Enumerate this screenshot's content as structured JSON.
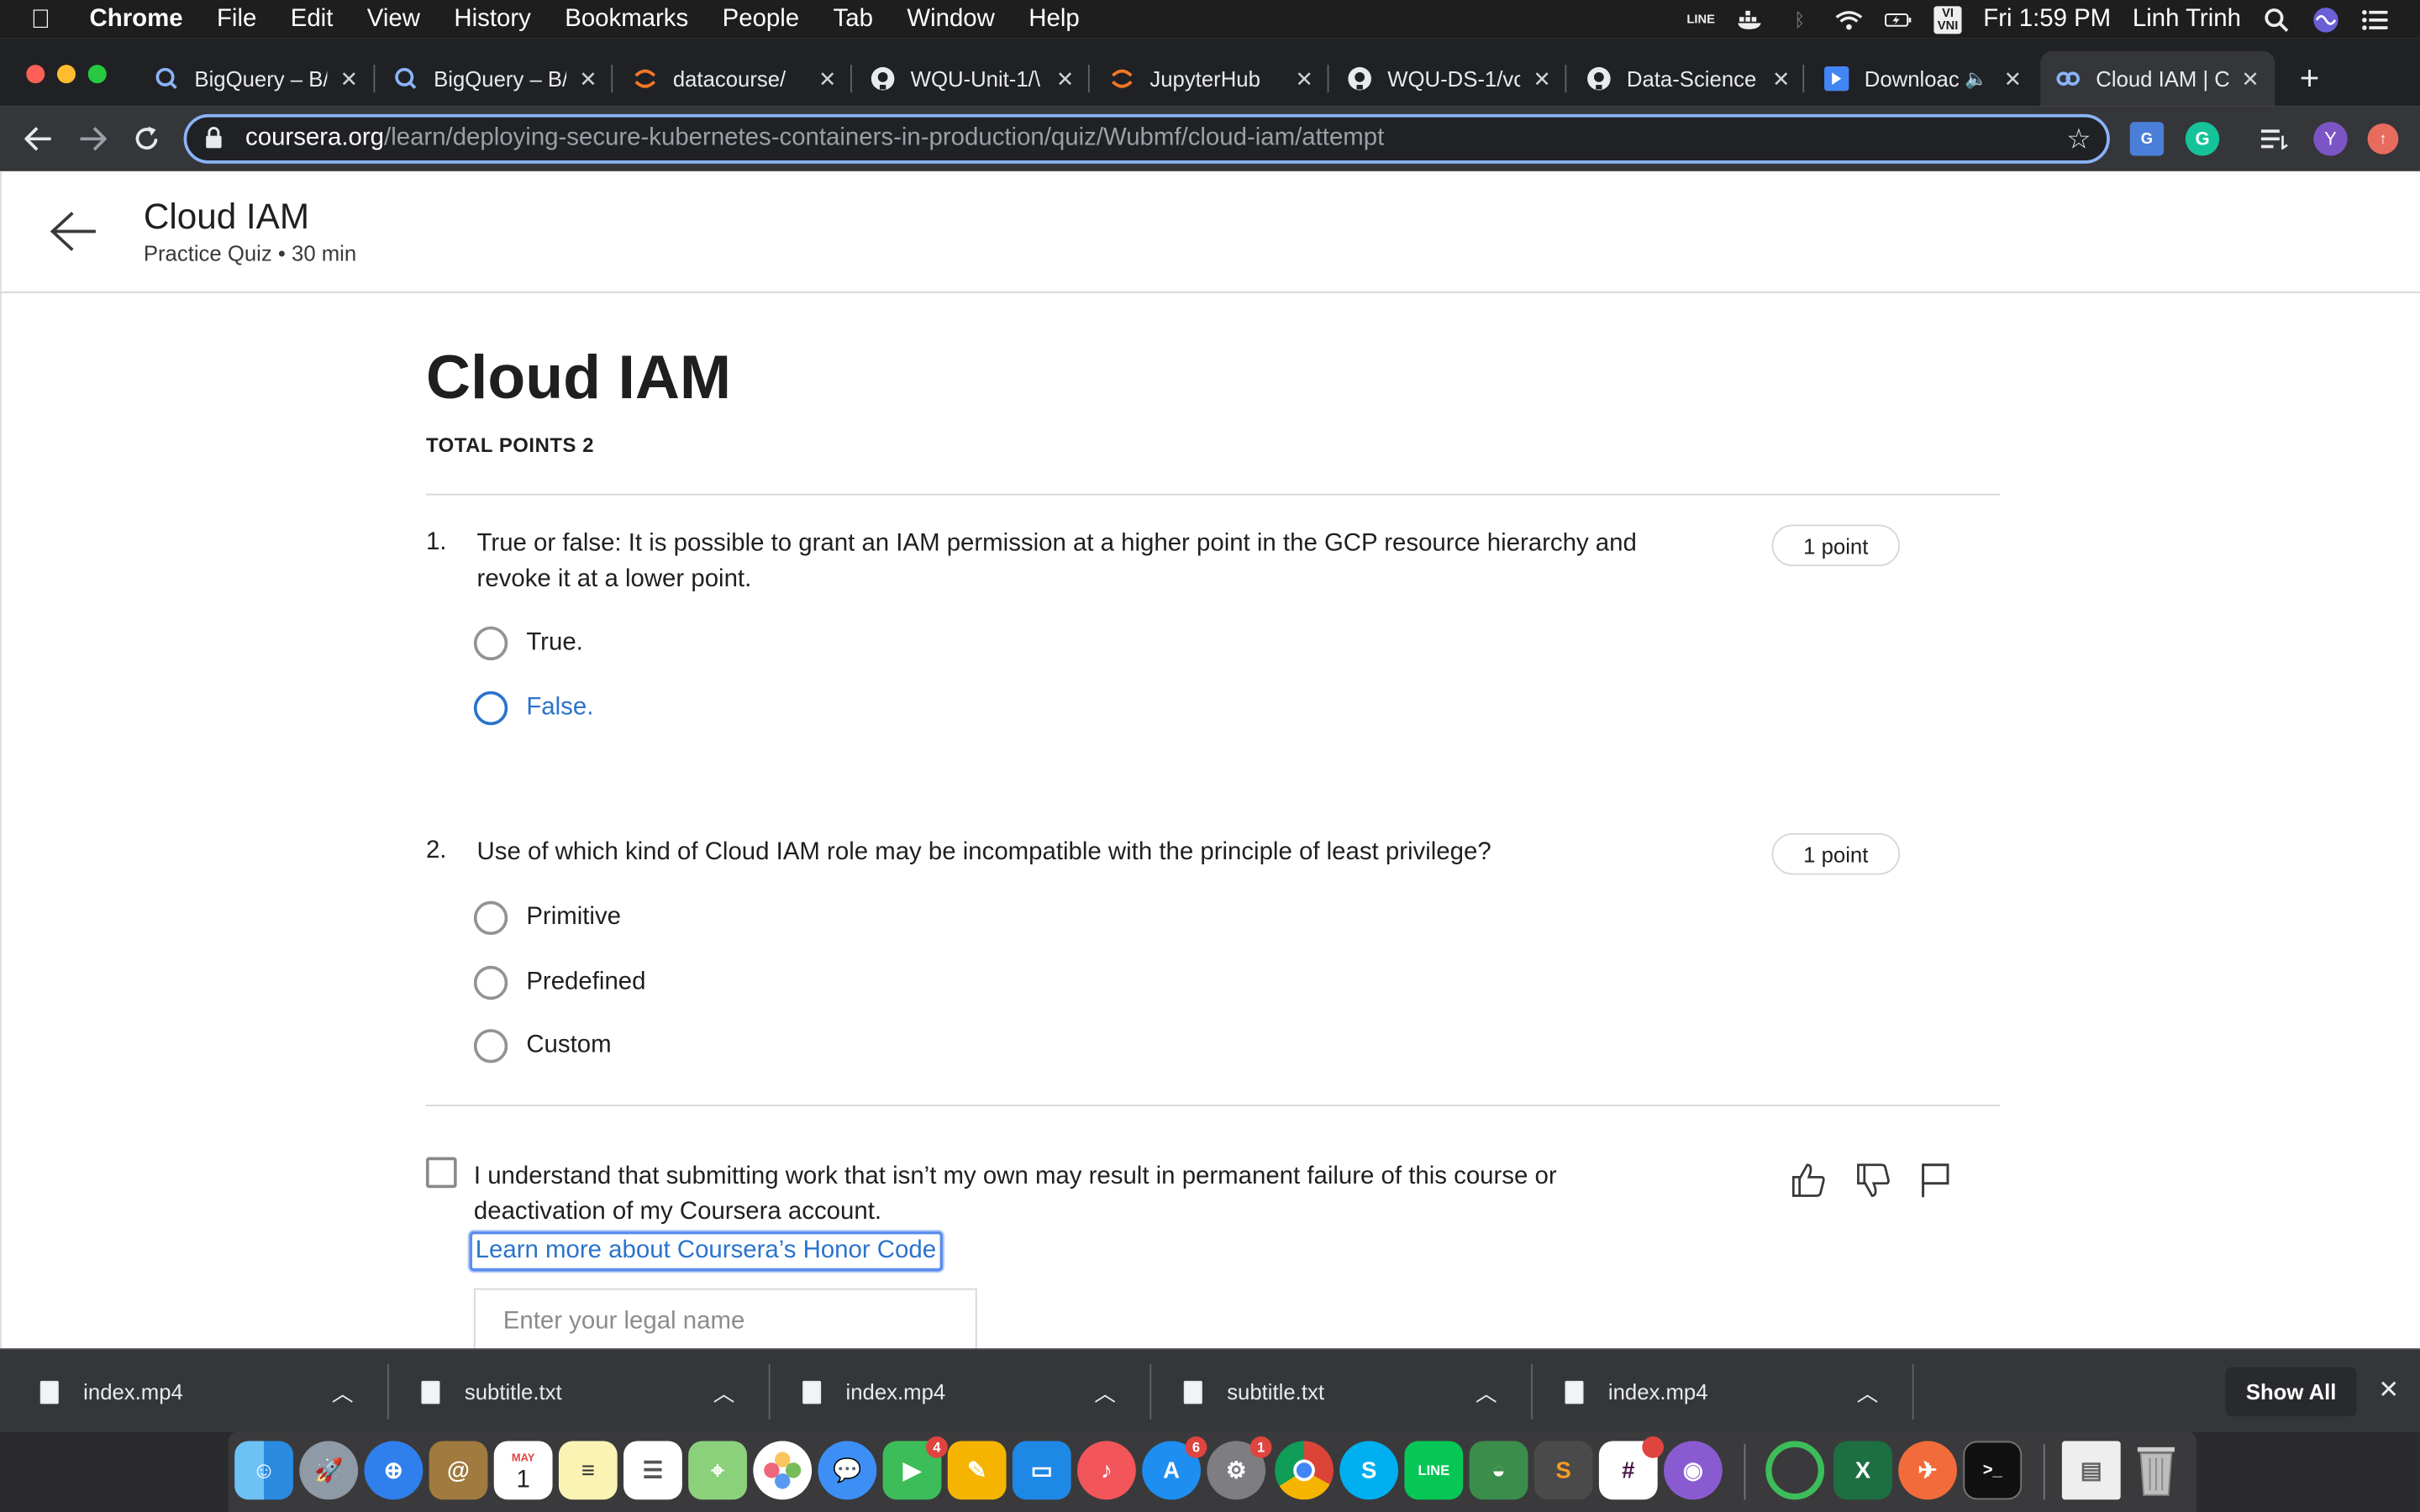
{
  "menubar": {
    "app": "Chrome",
    "items": [
      "File",
      "Edit",
      "View",
      "History",
      "Bookmarks",
      "People",
      "Tab",
      "Window",
      "Help"
    ],
    "clock": "Fri 1:59 PM",
    "user": "Linh Trinh",
    "input_source": "VI VNI"
  },
  "tabs": [
    {
      "title": "BigQuery – B/",
      "icon": "bigquery-icon"
    },
    {
      "title": "BigQuery – B/",
      "icon": "bigquery-icon"
    },
    {
      "title": "datacourse/",
      "icon": "jupyter-icon"
    },
    {
      "title": "WQU-Unit-1/\\",
      "icon": "github-icon"
    },
    {
      "title": "JupyterHub",
      "icon": "jupyter-icon"
    },
    {
      "title": "WQU-DS-1/vc",
      "icon": "github-icon"
    },
    {
      "title": "Data-Science",
      "icon": "github-icon"
    },
    {
      "title": "Downloac",
      "icon": "download-page-icon"
    },
    {
      "title": "Cloud IAM | C",
      "icon": "coursera-icon"
    }
  ],
  "address_bar": {
    "domain": "coursera.org",
    "path": "/learn/deploying-secure-kubernetes-containers-in-production/quiz/Wubmf/cloud-iam/attempt"
  },
  "extensions": {
    "profile_initial": "Y"
  },
  "header": {
    "title": "Cloud IAM",
    "subtitle": "Practice Quiz • 30 min"
  },
  "quiz": {
    "title": "Cloud IAM",
    "total_points": "TOTAL POINTS 2",
    "questions": [
      {
        "number": "1.",
        "text": "True or false: It is possible to grant an IAM permission at a higher point in the GCP resource hierarchy and revoke it at a lower point.",
        "points": "1 point",
        "options": [
          "True.",
          "False."
        ]
      },
      {
        "number": "2.",
        "text": "Use of which kind of Cloud IAM role may be incompatible with the principle of least privilege?",
        "points": "1 point",
        "options": [
          "Primitive",
          "Predefined",
          "Custom"
        ]
      }
    ],
    "honor_code": {
      "statement": "I understand that submitting work that isn’t my own may result in permanent failure of this course or deactivation of my Coursera account.",
      "link": "Learn more about Coursera’s Honor Code",
      "legal_name_placeholder": "Enter your legal name"
    }
  },
  "downloads": {
    "items": [
      "index.mp4",
      "subtitle.txt",
      "index.mp4",
      "subtitle.txt",
      "index.mp4"
    ],
    "show_all": "Show All"
  },
  "dock": {
    "calendar_month": "MAY",
    "calendar_day": "1",
    "badges": {
      "facetime": "4",
      "app_store": "6",
      "system_prefs": "1"
    }
  },
  "colors": {
    "accent": "#2a73cc",
    "chrome_dark": "#202124",
    "chrome_toolbar": "#35363a"
  }
}
